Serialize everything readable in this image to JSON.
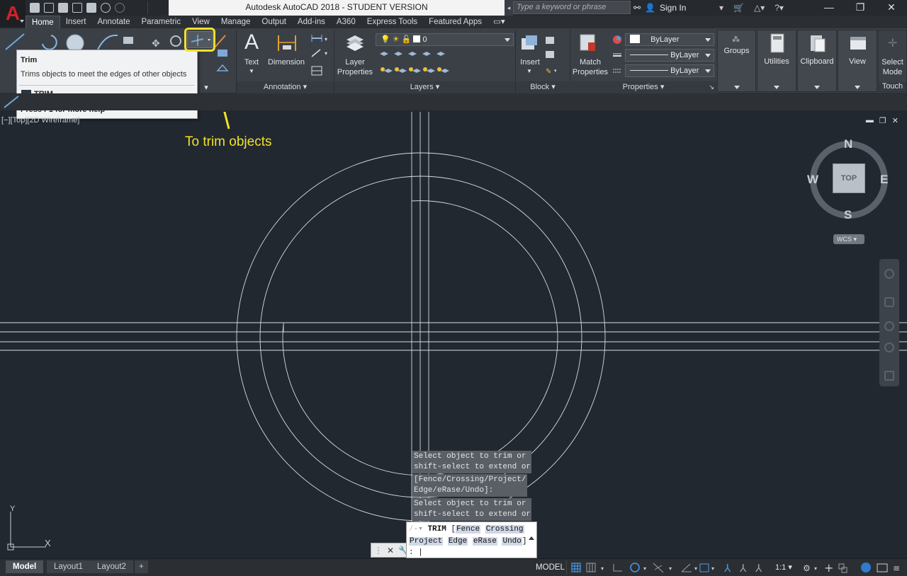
{
  "app": {
    "title": "Autodesk AutoCAD 2018 - STUDENT VERSION",
    "search_placeholder": "Type a keyword or phrase",
    "sign_in": "Sign In"
  },
  "ribbon_tabs": [
    "Home",
    "Insert",
    "Annotate",
    "Parametric",
    "View",
    "Manage",
    "Output",
    "Add-ins",
    "A360",
    "Express Tools",
    "Featured Apps"
  ],
  "ribbon": {
    "draw_label_partial": "Lin",
    "text_label": "Text",
    "dimension_label": "Dimension",
    "layer_properties_label": "Layer\nProperties",
    "layer_value": "0",
    "insert_label": "Insert",
    "match_properties_label": "Match\nProperties",
    "bylayer_color": "ByLayer",
    "bylayer_linetype": "ByLayer",
    "bylayer_lineweight": "ByLayer",
    "groups_label": "Groups",
    "utilities_label": "Utilities",
    "clipboard_label": "Clipboard",
    "view_label": "View",
    "select_mode_label": "Select\nMode",
    "touch_label": "Touch",
    "panel_annotation": "Annotation",
    "panel_layers": "Layers",
    "panel_block": "Block",
    "panel_properties": "Properties"
  },
  "tooltip": {
    "title": "Trim",
    "description": "Trims objects to meet the edges of other objects",
    "command": "TRIM",
    "help": "Press F1 for more help"
  },
  "viewport": {
    "label": "[−][Top][2D Wireframe]",
    "viewcube_face": "TOP",
    "compass_n": "N",
    "compass_s": "S",
    "compass_e": "E",
    "compass_w": "W",
    "wcs": "WCS",
    "ucs_y": "Y",
    "ucs_x": "X"
  },
  "annotation": {
    "text": "To trim objects",
    "color": "#f2e12a"
  },
  "command_history": [
    "Select object to trim or\nshift-select to extend or",
    "[Fence/Crossing/Project/\nEdge/eRase/Undo]:",
    "Select object to trim or\nshift-select to extend or"
  ],
  "command_line": {
    "command": "TRIM",
    "bracket_open": "[",
    "options_row1": [
      "Fence",
      "Crossing"
    ],
    "options_row2": [
      "Project",
      "Edge",
      "eRase",
      "Undo"
    ],
    "bracket_close": "]",
    "prompt": ": |"
  },
  "statusbar": {
    "layout_tabs": [
      "Model",
      "Layout1",
      "Layout2"
    ],
    "add_tab": "+",
    "model_button": "MODEL",
    "scale": "1:1"
  }
}
